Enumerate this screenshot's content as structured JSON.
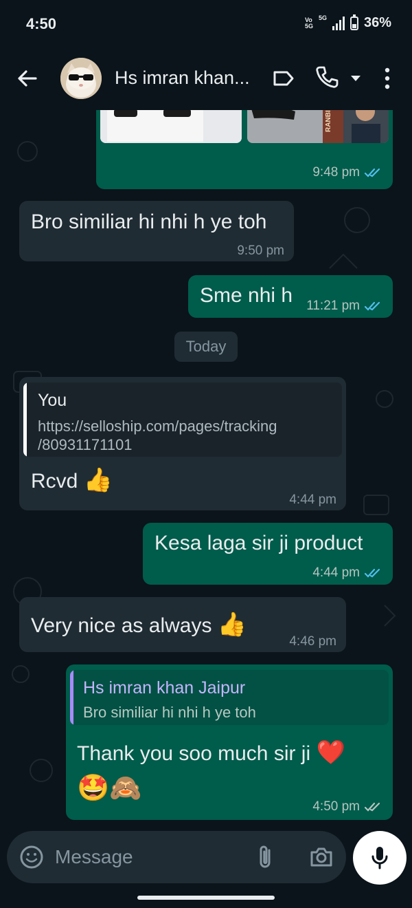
{
  "status_bar": {
    "time": "4:50",
    "volte": "Vo\n5G",
    "network": "5G",
    "battery": "36%"
  },
  "header": {
    "contact_name": "Hs imran khan...",
    "icons": [
      "back-arrow-icon",
      "label-icon",
      "phone-icon",
      "dropdown-icon",
      "more-icon"
    ]
  },
  "messages": {
    "m1_time": "9:48 pm",
    "m1_image_text": "RANBIR'S",
    "m2_text": "Bro similiar hi nhi h ye toh",
    "m2_time": "9:50 pm",
    "m3_text": "Sme nhi h",
    "m3_time": "11:21 pm",
    "date_chip": "Today",
    "m4_quote_author": "You",
    "m4_quote_line1": "https://selloship.com/pages/tracking",
    "m4_quote_line2": "/80931171101",
    "m4_text": "Rcvd",
    "m4_emoji": "👍",
    "m4_time": "4:44 pm",
    "m5_text": "Kesa laga sir ji product",
    "m5_time": "4:44 pm",
    "m6_text": "Very nice as always",
    "m6_emoji": "👍",
    "m6_time": "4:46 pm",
    "m7_quote_author": "Hs imran khan Jaipur",
    "m7_quote_text": "Bro similiar hi nhi h ye toh",
    "m7_text": "Thank you soo much sir ji",
    "m7_emoji_heart": "❤️",
    "m7_emojis": "🤩🙈",
    "m7_time": "4:50 pm"
  },
  "composer": {
    "placeholder": "Message"
  },
  "colors": {
    "background": "#0b141a",
    "incoming": "#202c33",
    "outgoing": "#005c4b",
    "read_tick": "#53bdeb",
    "quote_you": "#ffffff",
    "quote_contact": "#a78bfa"
  }
}
